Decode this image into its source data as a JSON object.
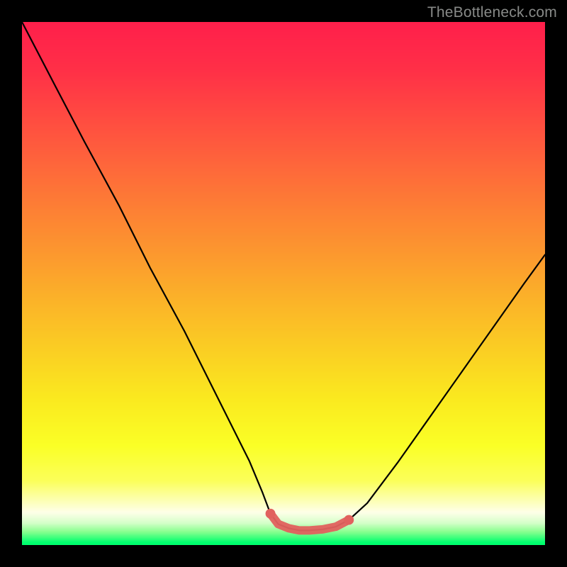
{
  "watermark": {
    "text": "TheBottleneck.com"
  },
  "gradient": {
    "stops": [
      {
        "pos": 0.0,
        "color": "#ff1f4b"
      },
      {
        "pos": 0.09,
        "color": "#ff2f47"
      },
      {
        "pos": 0.18,
        "color": "#ff4a41"
      },
      {
        "pos": 0.27,
        "color": "#fe653b"
      },
      {
        "pos": 0.36,
        "color": "#fd8034"
      },
      {
        "pos": 0.45,
        "color": "#fc9a2e"
      },
      {
        "pos": 0.54,
        "color": "#fbb528"
      },
      {
        "pos": 0.63,
        "color": "#facf23"
      },
      {
        "pos": 0.72,
        "color": "#fae91f"
      },
      {
        "pos": 0.81,
        "color": "#faff26"
      },
      {
        "pos": 0.8775,
        "color": "#fbff5a"
      },
      {
        "pos": 0.9075,
        "color": "#fcffa2"
      },
      {
        "pos": 0.9375,
        "color": "#feffe8"
      },
      {
        "pos": 0.9575,
        "color": "#d6ffca"
      },
      {
        "pos": 0.975,
        "color": "#87ff8e"
      },
      {
        "pos": 0.995,
        "color": "#00ff6e"
      },
      {
        "pos": 1.0,
        "color": "#00ff6e"
      }
    ]
  },
  "chart_data": {
    "type": "line",
    "title": "",
    "xlabel": "",
    "ylabel": "",
    "xlim": [
      0,
      100
    ],
    "ylim": [
      0,
      100
    ],
    "annotations": [
      "TheBottleneck.com"
    ],
    "series": [
      {
        "name": "left-curve",
        "x": [
          0.0,
          6.5,
          12.0,
          18.5,
          24.5,
          31.0,
          37.0,
          43.5,
          46.0,
          47.5
        ],
        "y": [
          100.0,
          87.5,
          77.0,
          65.0,
          53.0,
          41.0,
          29.0,
          16.0,
          10.0,
          6.0
        ]
      },
      {
        "name": "plateau",
        "x": [
          47.5,
          49.0,
          51.0,
          53.0,
          55.0,
          57.5,
          60.0,
          62.5
        ],
        "y": [
          6.0,
          4.0,
          3.2,
          2.8,
          2.8,
          3.0,
          3.5,
          4.8
        ]
      },
      {
        "name": "right-curve",
        "x": [
          62.5,
          66.0,
          72.0,
          78.0,
          84.0,
          90.0,
          96.0,
          100.0
        ],
        "y": [
          4.8,
          8.0,
          16.0,
          24.5,
          33.0,
          41.5,
          50.0,
          55.5
        ]
      }
    ],
    "highlight_band": {
      "name": "red-band",
      "color": "#e1615e",
      "x": [
        47.5,
        49.0,
        51.0,
        53.0,
        55.0,
        57.5,
        60.0,
        62.5
      ],
      "y": [
        6.0,
        4.0,
        3.2,
        2.8,
        2.8,
        3.0,
        3.5,
        4.8
      ],
      "thickness": 12
    }
  }
}
